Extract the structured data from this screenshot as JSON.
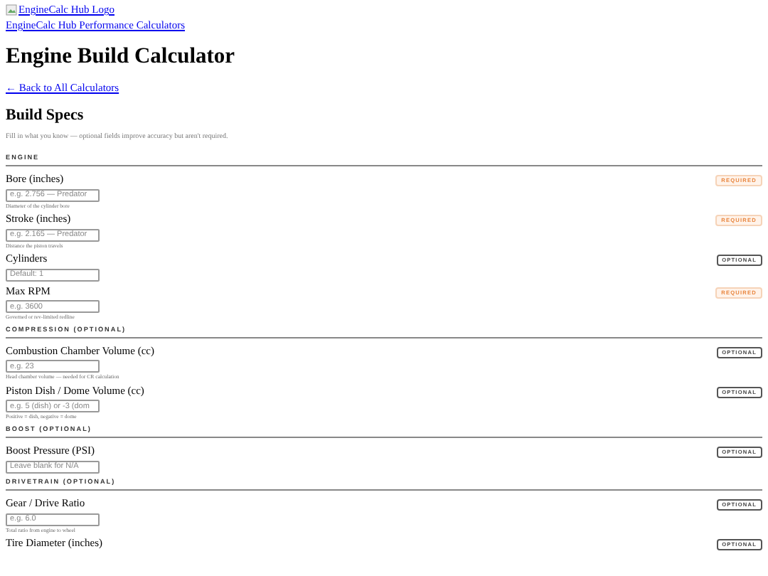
{
  "header": {
    "logo_alt": "EngineCalc Hub Logo",
    "site_link": "EngineCalc Hub Performance Calculators"
  },
  "title": "Engine Build Calculator",
  "back_link": "← Back to All Calculators",
  "form_title": "Build Specs",
  "intro": "Fill in what you know — optional fields improve accuracy but aren't required.",
  "sections": [
    {
      "heading": "ENGINE",
      "fields": [
        {
          "label": "Bore (inches)",
          "placeholder": "e.g. 2.756 — Predator",
          "hint": "Diameter of the cylinder bore",
          "badge": {
            "kind": "required",
            "text": "REQUIRED"
          }
        },
        {
          "label": "Stroke (inches)",
          "placeholder": "e.g. 2.165 — Predator",
          "hint": "Distance the piston travels",
          "badge": {
            "kind": "required",
            "text": "REQUIRED"
          }
        },
        {
          "label": "Cylinders",
          "placeholder": "Default: 1",
          "badge": {
            "kind": "optional",
            "text": "OPTIONAL"
          }
        },
        {
          "label": "Max RPM",
          "placeholder": "e.g. 3600",
          "hint": "Governed or rev-limited redline",
          "badge": {
            "kind": "required",
            "text": "REQUIRED"
          }
        }
      ]
    },
    {
      "heading": "COMPRESSION (OPTIONAL)",
      "fields": [
        {
          "label": "Combustion Chamber Volume (cc)",
          "placeholder": "e.g. 23",
          "hint": "Head chamber volume — needed for CR calculation",
          "badge": {
            "kind": "optional",
            "text": "OPTIONAL"
          }
        },
        {
          "label": "Piston Dish / Dome Volume (cc)",
          "placeholder": "e.g. 5 (dish) or -3 (dom",
          "hint": "Positive = dish, negative = dome",
          "badge": {
            "kind": "optional",
            "text": "OPTIONAL"
          }
        }
      ]
    },
    {
      "heading": "BOOST (OPTIONAL)",
      "fields": [
        {
          "label": "Boost Pressure (PSI)",
          "placeholder": "Leave blank for N/A",
          "badge": {
            "kind": "optional",
            "text": "OPTIONAL"
          }
        }
      ]
    },
    {
      "heading": "DRIVETRAIN (OPTIONAL)",
      "fields": [
        {
          "label": "Gear / Drive Ratio",
          "placeholder": "e.g. 6.0",
          "hint": "Total ratio from engine to wheel",
          "badge": {
            "kind": "optional",
            "text": "OPTIONAL"
          }
        },
        {
          "label": "Tire Diameter (inches)",
          "badge": {
            "kind": "optional",
            "text": "OPTIONAL"
          }
        }
      ]
    }
  ]
}
